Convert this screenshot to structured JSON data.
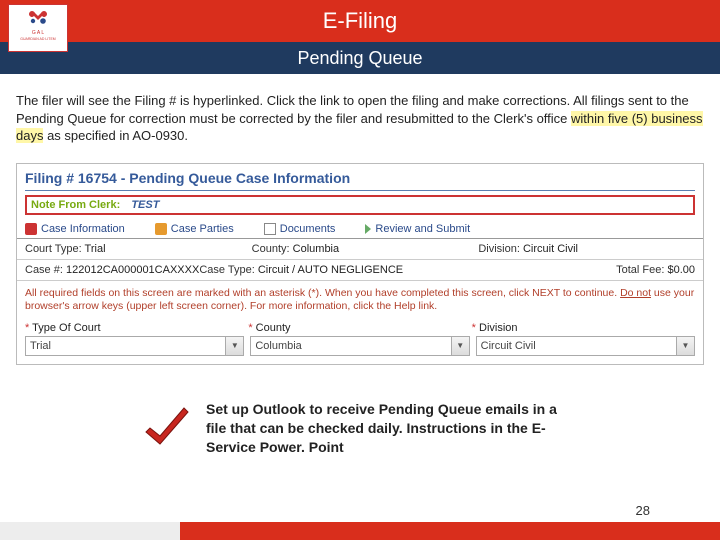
{
  "header": {
    "title": "E-Filing",
    "subtitle": "Pending Queue",
    "logo_line1": "G A L",
    "logo_line2": "GUARDIAN AD LITEM"
  },
  "body": {
    "intro_a": "The filer will see the Filing # is hyperlinked. Click the link to open the filing and make corrections. All filings sent to the Pending Queue for correction must be corrected by the filer and resubmitted to the Clerk's office ",
    "intro_hl": "within five (5) business days",
    "intro_b": " as specified in AO-0930."
  },
  "screencap": {
    "heading": "Filing # 16754 - Pending Queue Case Information",
    "clerk_label": "Note From Clerk:",
    "clerk_value": "TEST",
    "tabs": [
      "Case Information",
      "Case Parties",
      "Documents",
      "Review and Submit"
    ],
    "row1": {
      "court_type_label": "Court Type:",
      "court_type_value": "Trial",
      "county_label": "County:",
      "county_value": "Columbia",
      "division_label": "Division:",
      "division_value": "Circuit Civil"
    },
    "row2": {
      "case_num_label": "Case #:",
      "case_num_value": "122012CA000001CAXXXX",
      "case_type_label": "Case Type:",
      "case_type_value": "Circuit / AUTO NEGLIGENCE",
      "fee_label": "Total Fee:",
      "fee_value": "$0.00"
    },
    "instructions_a": "All required fields on this screen are marked with an asterisk (*). When you have completed this screen, click NEXT to continue. ",
    "instructions_ul": "Do not",
    "instructions_b": " use your browser's arrow keys (upper left screen corner). For more information, click the Help link.",
    "form_headers": [
      "Type Of Court",
      "County",
      "Division"
    ],
    "form_values": [
      "Trial",
      "Columbia",
      "Circuit Civil"
    ]
  },
  "tip": "Set up Outlook to receive Pending Queue emails in a file that can be checked daily. Instructions in the E-Service Power. Point",
  "page_number": "28"
}
